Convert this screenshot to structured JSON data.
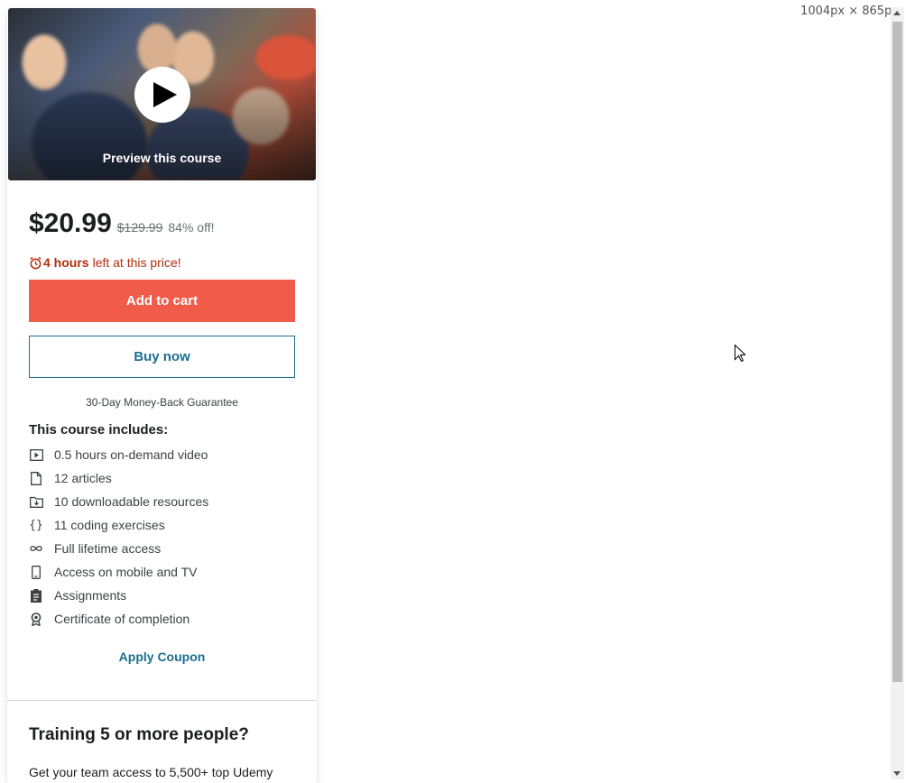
{
  "viewport_label": "1004px × 865px",
  "preview": {
    "label": "Preview this course",
    "play_icon": "play-icon"
  },
  "pricing": {
    "current": "$20.99",
    "original": "$129.99",
    "discount": "84% off!",
    "timer_bold": "4 hours",
    "timer_rest": "left at this price!",
    "timer_icon": "alarm-clock-icon"
  },
  "buttons": {
    "add_to_cart": "Add to cart",
    "buy_now": "Buy now"
  },
  "guarantee": "30-Day Money-Back Guarantee",
  "includes": {
    "title": "This course includes:",
    "items": [
      {
        "icon": "video-icon",
        "label": "0.5 hours on-demand video"
      },
      {
        "icon": "file-icon",
        "label": "12 articles"
      },
      {
        "icon": "download-folder-icon",
        "label": "10 downloadable resources"
      },
      {
        "icon": "code-braces-icon",
        "label": "11 coding exercises"
      },
      {
        "icon": "infinity-icon",
        "label": "Full lifetime access"
      },
      {
        "icon": "mobile-icon",
        "label": "Access on mobile and TV"
      },
      {
        "icon": "clipboard-icon",
        "label": "Assignments"
      },
      {
        "icon": "certificate-icon",
        "label": "Certificate of completion"
      }
    ]
  },
  "coupon": "Apply Coupon",
  "training": {
    "title": "Training 5 or more people?",
    "text": "Get your team access to 5,500+ top Udemy"
  },
  "colors": {
    "cart": "#f15b4a",
    "link": "#1b6f8f",
    "timer": "#b32d0f"
  }
}
